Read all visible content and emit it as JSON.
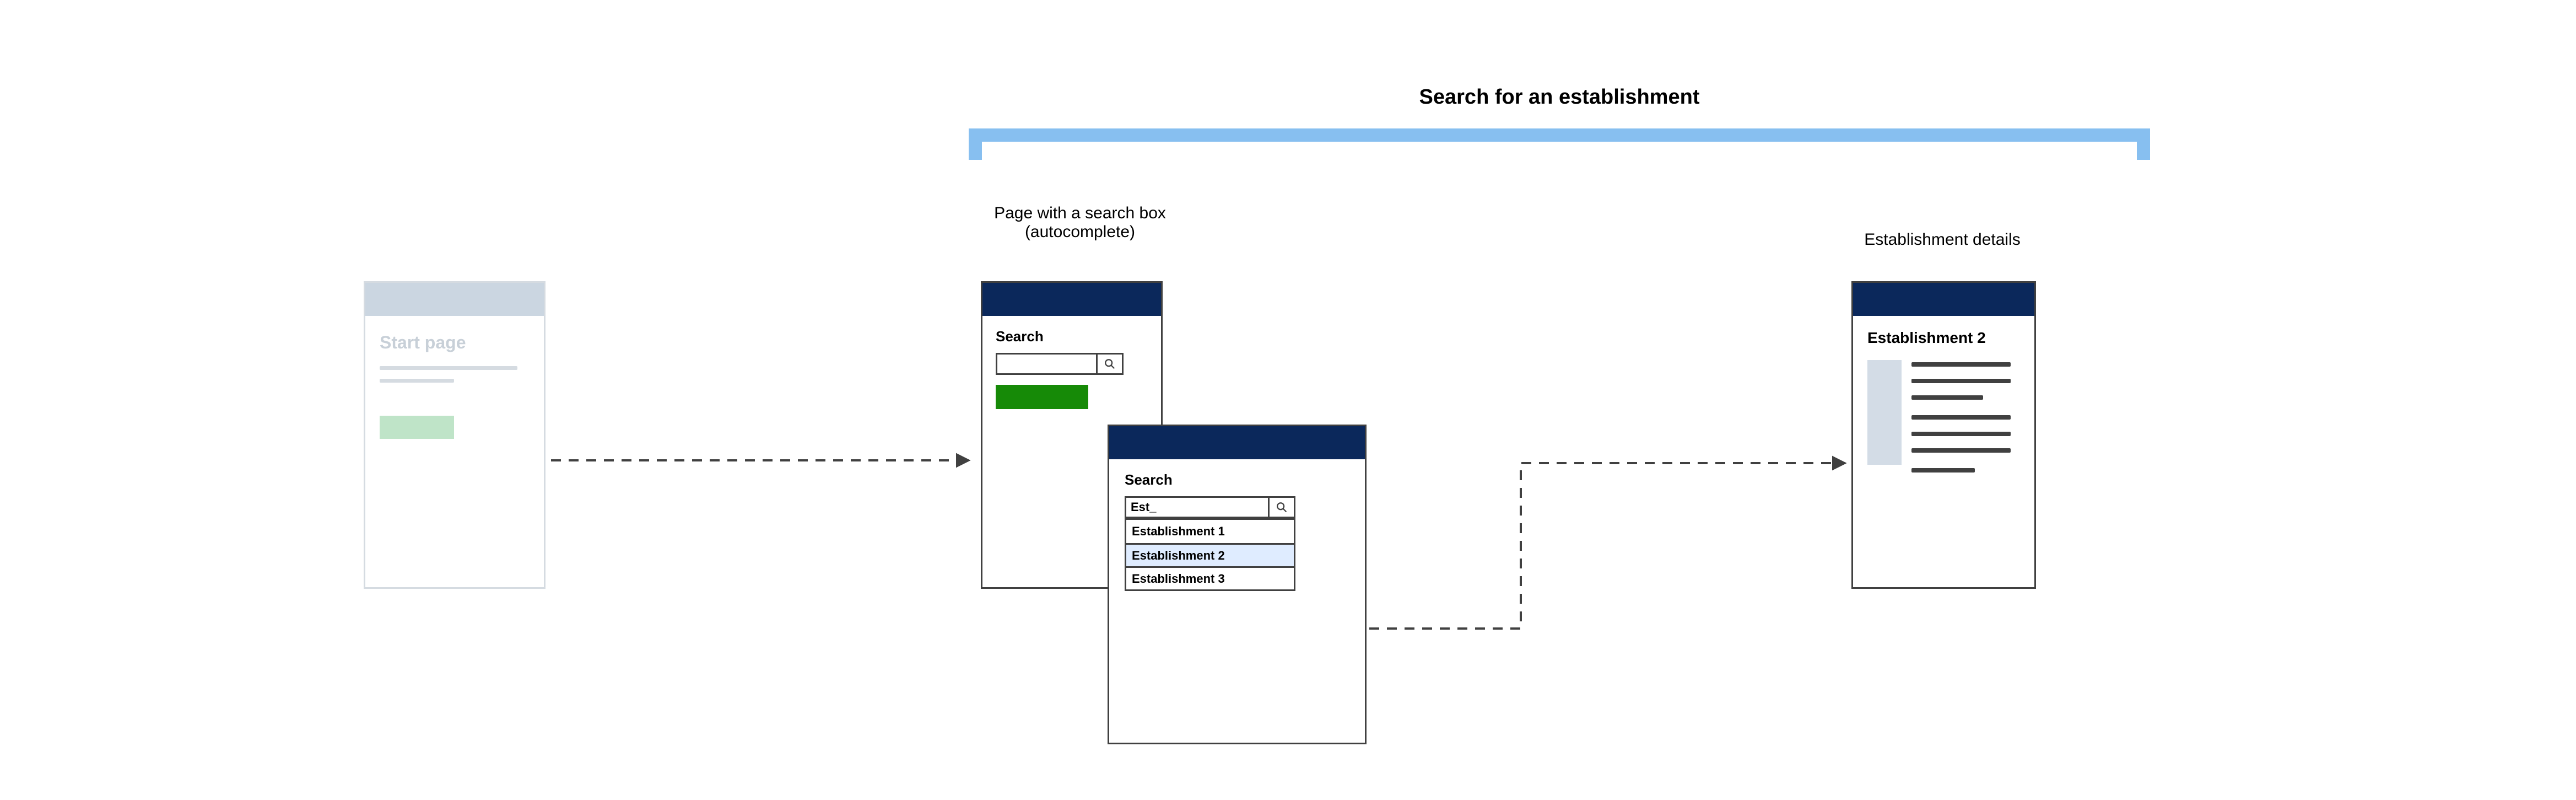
{
  "bracket_title": "Search for an establishment",
  "captions": {
    "search_caption_line1": "Page with a search box",
    "search_caption_line2": "(autocomplete)",
    "details_caption": "Establishment details"
  },
  "start_page": {
    "title": "Start page"
  },
  "search_page": {
    "label": "Search"
  },
  "autocomplete_page": {
    "label": "Search",
    "query": "Est_",
    "items": [
      {
        "label": "Establishment 1",
        "selected": false
      },
      {
        "label": "Establishment 2",
        "selected": true
      },
      {
        "label": "Establishment 3",
        "selected": false
      }
    ]
  },
  "details_page": {
    "title": "Establishment 2"
  },
  "colors": {
    "bracket": "#87bff0",
    "navy": "#0b285b",
    "green": "#168a07",
    "selected": "#dfecff",
    "muted_line": "#d5dbe1",
    "muted_btn": "#bfe4c8",
    "thumb": "#d3dce6",
    "stroke": "#404040"
  }
}
